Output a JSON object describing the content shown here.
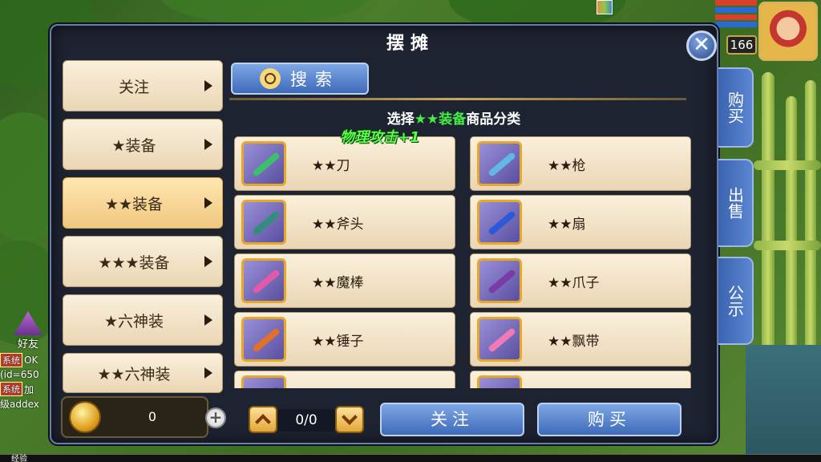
{
  "panel": {
    "title": "摆摊"
  },
  "side_tabs": [
    {
      "label": "购买"
    },
    {
      "label": "出售"
    },
    {
      "label": "公示"
    }
  ],
  "categories": [
    {
      "label": "关注"
    },
    {
      "label": "★装备"
    },
    {
      "label": "★★装备",
      "selected": true
    },
    {
      "label": "★★★装备"
    },
    {
      "label": "★六神装"
    },
    {
      "label": "★★六神装"
    }
  ],
  "search": {
    "label": "搜索"
  },
  "hint": {
    "prefix": "选择",
    "highlight": "★★装备",
    "suffix": "商品分类"
  },
  "float_text": "物理攻击+1",
  "items": [
    {
      "name": "★★刀",
      "icon": "blade-icon",
      "color": "#3bbf6a"
    },
    {
      "name": "★★枪",
      "icon": "spear-icon",
      "color": "#63b7e6"
    },
    {
      "name": "★★斧头",
      "icon": "axe-icon",
      "color": "#2f8f7a"
    },
    {
      "name": "★★扇",
      "icon": "fan-icon",
      "color": "#2a5ad8"
    },
    {
      "name": "★★魔棒",
      "icon": "wand-icon",
      "color": "#e05aa8"
    },
    {
      "name": "★★爪子",
      "icon": "claw-icon",
      "color": "#7a3aa8"
    },
    {
      "name": "★★锤子",
      "icon": "hammer-icon",
      "color": "#e0702a"
    },
    {
      "name": "★★飘带",
      "icon": "ribbon-icon",
      "color": "#f07ab8"
    },
    {
      "name": "",
      "icon": "item-icon",
      "color": "#3a6ab8"
    },
    {
      "name": "",
      "icon": "item-icon",
      "color": "#6a6ad8"
    }
  ],
  "money": {
    "value": "0"
  },
  "pagination": {
    "label": "0/0"
  },
  "actions": {
    "follow": "关注",
    "buy": "购买"
  },
  "hud": {
    "level": "166"
  },
  "friend": {
    "label": "好友"
  },
  "chat": [
    {
      "tag": "系统",
      "text": "OK"
    },
    {
      "tag": "",
      "text": "(id=650"
    },
    {
      "tag": "系统",
      "text": "加"
    },
    {
      "tag": "",
      "text": "级addex"
    }
  ],
  "exp_label": "经验"
}
